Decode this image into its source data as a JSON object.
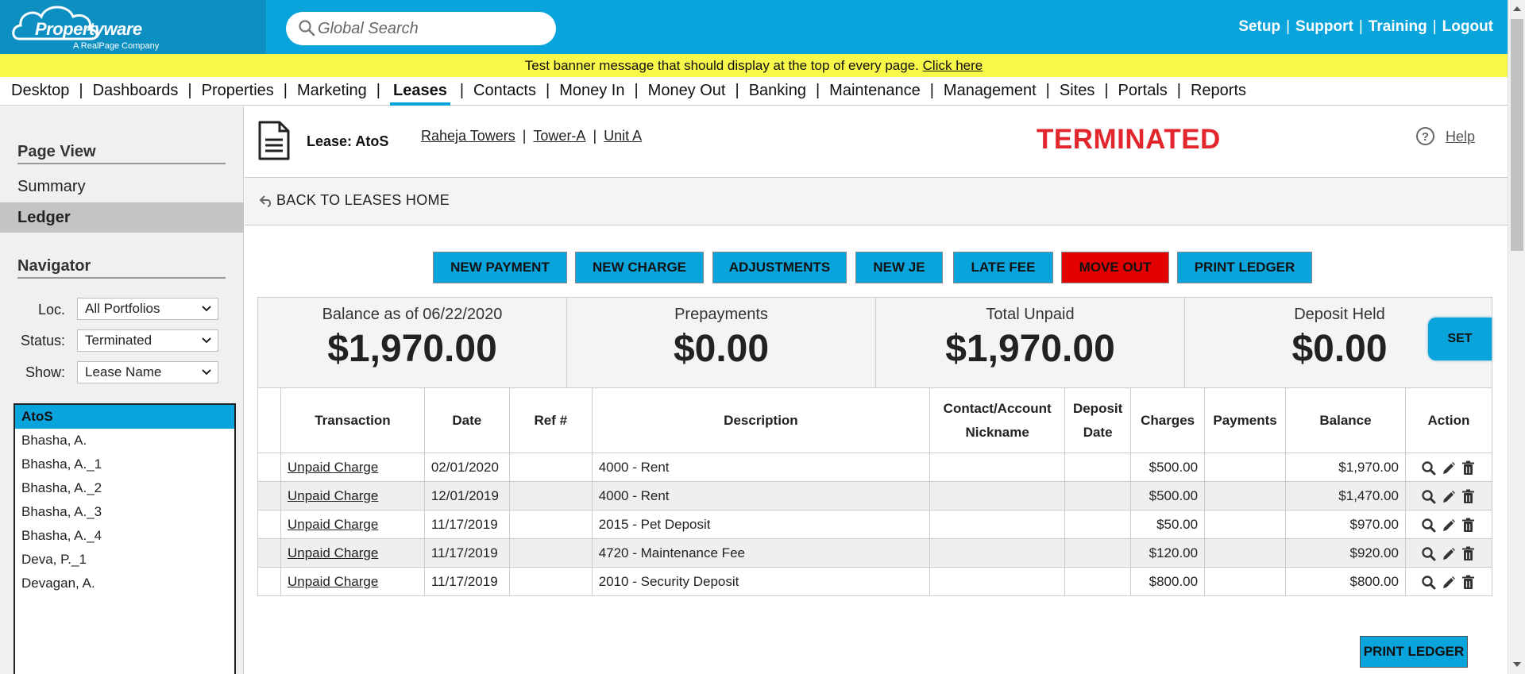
{
  "header": {
    "logo_text": "Propertyware",
    "logo_sub": "A RealPage Company",
    "search_placeholder": "Global Search",
    "top_links": [
      "Setup",
      "Support",
      "Training",
      "Logout"
    ]
  },
  "banner": {
    "message": "Test banner message that should display at the top of every page.",
    "link": "Click here"
  },
  "nav": {
    "items": [
      "Desktop",
      "Dashboards",
      "Properties",
      "Marketing",
      "Leases",
      "Contacts",
      "Money In",
      "Money Out",
      "Banking",
      "Maintenance",
      "Management",
      "Sites",
      "Portals",
      "Reports"
    ],
    "active": "Leases"
  },
  "sidebar": {
    "page_view_heading": "Page View",
    "links": [
      "Summary",
      "Ledger"
    ],
    "active_link": "Ledger",
    "navigator_heading": "Navigator",
    "filters": [
      {
        "label": "Loc.",
        "value": "All Portfolios"
      },
      {
        "label": "Status:",
        "value": "Terminated"
      },
      {
        "label": "Show:",
        "value": "Lease Name"
      }
    ],
    "leases": [
      "AtoS",
      "Bhasha, A.",
      "Bhasha, A._1",
      "Bhasha, A._2",
      "Bhasha, A._3",
      "Bhasha, A._4",
      "Deva, P._1",
      "Devagan, A."
    ],
    "selected_lease": "AtoS"
  },
  "lease": {
    "title": "Lease: AtoS",
    "crumbs": [
      "Raheja Towers",
      "Tower-A",
      "Unit A"
    ],
    "status": "TERMINATED",
    "help": "Help",
    "back": "BACK TO LEASES HOME"
  },
  "actions": [
    "NEW PAYMENT",
    "NEW CHARGE",
    "ADJUSTMENTS",
    "NEW JE",
    "LATE FEE",
    "MOVE OUT",
    "PRINT LEDGER"
  ],
  "summary": [
    {
      "label": "Balance as of 06/22/2020",
      "value": "$1,970.00"
    },
    {
      "label": "Prepayments",
      "value": "$0.00"
    },
    {
      "label": "Total Unpaid",
      "value": "$1,970.00"
    },
    {
      "label": "Deposit Held",
      "value": "$0.00"
    }
  ],
  "set_button": "SET",
  "table": {
    "headers": [
      "Transaction",
      "Date",
      "Ref #",
      "Description",
      "Contact/Account Nickname",
      "Deposit Date",
      "Charges",
      "Payments",
      "Balance",
      "Action"
    ],
    "header_lines": {
      "contact": [
        "Contact/Account",
        "Nickname"
      ],
      "deposit": [
        "Deposit",
        "Date"
      ]
    },
    "rows": [
      {
        "transaction": "Unpaid Charge",
        "date": "02/01/2020",
        "ref": "",
        "description": "4000 - Rent",
        "contact": "",
        "deposit_date": "",
        "charges": "$500.00",
        "payments": "",
        "balance": "$1,970.00"
      },
      {
        "transaction": "Unpaid Charge",
        "date": "12/01/2019",
        "ref": "",
        "description": "4000 - Rent",
        "contact": "",
        "deposit_date": "",
        "charges": "$500.00",
        "payments": "",
        "balance": "$1,470.00"
      },
      {
        "transaction": "Unpaid Charge",
        "date": "11/17/2019",
        "ref": "",
        "description": "2015 - Pet Deposit",
        "contact": "",
        "deposit_date": "",
        "charges": "$50.00",
        "payments": "",
        "balance": "$970.00"
      },
      {
        "transaction": "Unpaid Charge",
        "date": "11/17/2019",
        "ref": "",
        "description": "4720 - Maintenance Fee",
        "contact": "",
        "deposit_date": "",
        "charges": "$120.00",
        "payments": "",
        "balance": "$920.00"
      },
      {
        "transaction": "Unpaid Charge",
        "date": "11/17/2019",
        "ref": "",
        "description": "2010 - Security Deposit",
        "contact": "",
        "deposit_date": "",
        "charges": "$800.00",
        "payments": "",
        "balance": "$800.00"
      }
    ],
    "row_action_icons": [
      "search-icon",
      "pencil-icon",
      "trash-icon"
    ]
  },
  "print_bottom": "PRINT LEDGER",
  "colors": {
    "header_blue": "#0aa4dc",
    "banner_yellow": "#f8f84a",
    "status_red": "#e2262e",
    "danger_button": "#e30000"
  }
}
